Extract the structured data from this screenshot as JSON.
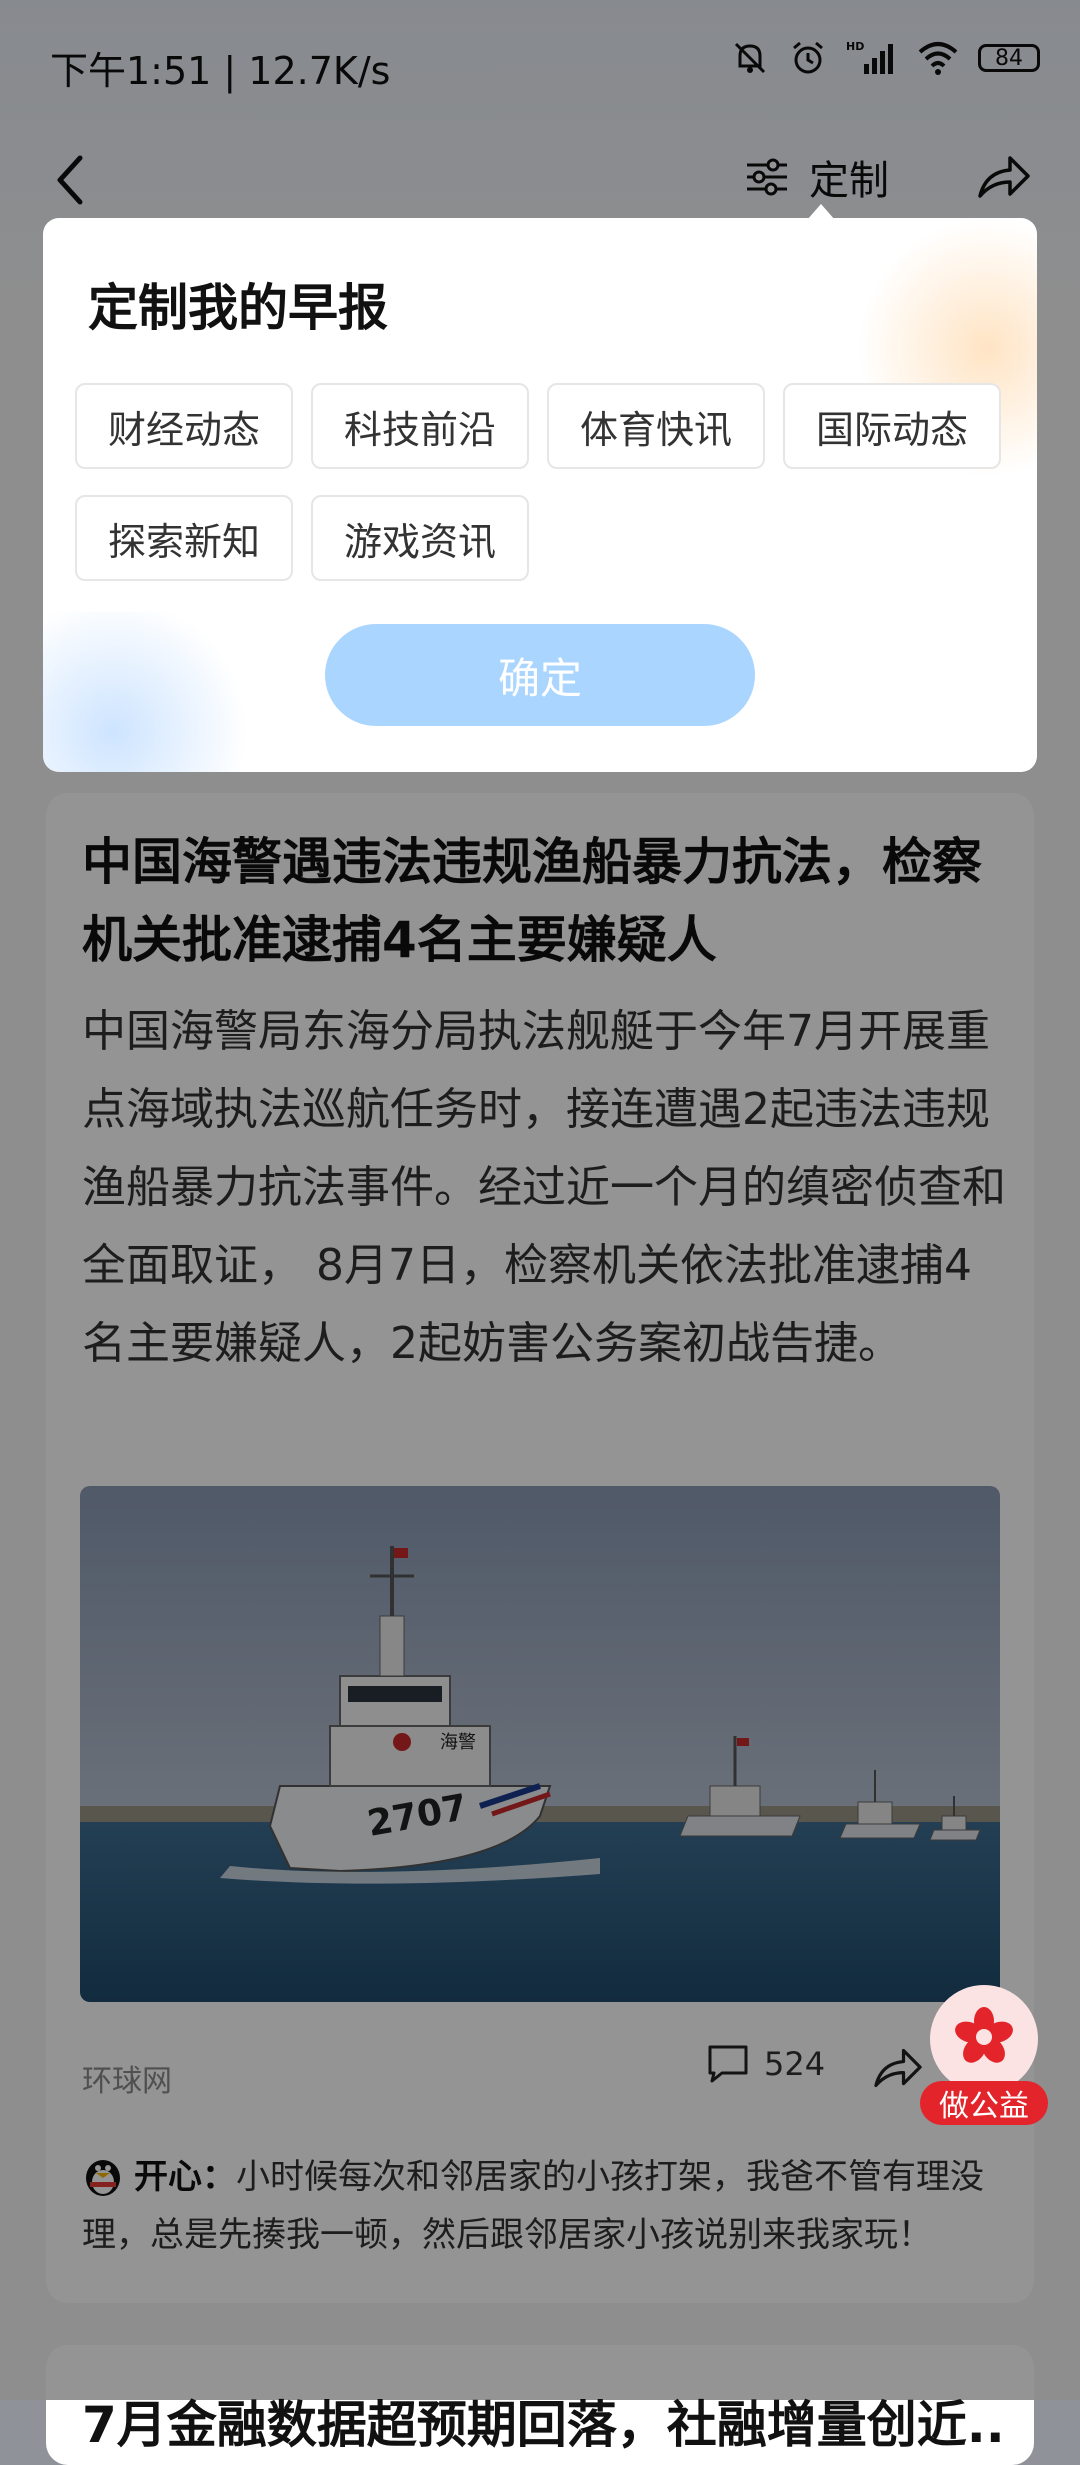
{
  "status_bar": {
    "time": "下午1:51 | 12.7K/s",
    "battery": "84",
    "network": "HD"
  },
  "nav": {
    "custom_label": "定制"
  },
  "popup": {
    "title": "定制我的早报",
    "tags": [
      "财经动态",
      "科技前沿",
      "体育快讯",
      "国际动态",
      "探索新知",
      "游戏资讯"
    ],
    "confirm_label": "确定"
  },
  "article": {
    "headline": "中国海警遇违法违规渔船暴力抗法，检察机关批准逮捕4名主要嫌疑人",
    "summary": "中国海警局东海分局执法舰艇于今年7月开展重点海域执法巡航任务时，接连遭遇2起违法违规渔船暴力抗法事件。经过近一个月的缜密侦查和全面取证， 8月7日，检察机关依法批准逮捕4名主要嫌疑人，2起妨害公务案初战告捷。",
    "source": "环球网",
    "comment_count": "524",
    "ship_hull_text": "海警",
    "ship_number": "2707",
    "charity_label": "做公益",
    "top_comment": {
      "user": "开心：",
      "text": "小时候每次和邻居家的小孩打架，我爸不管有理没理，总是先揍我一顿，然后跟邻居家小孩说别来我家玩！"
    }
  },
  "next_article": {
    "headline_partial": "7月金融数据超预期回落，社融增量创近..."
  },
  "colors": {
    "confirm_bg": "#a9d5ff",
    "charity_red": "#e3242b",
    "overlay": "rgba(0,0,0,0.42)"
  }
}
